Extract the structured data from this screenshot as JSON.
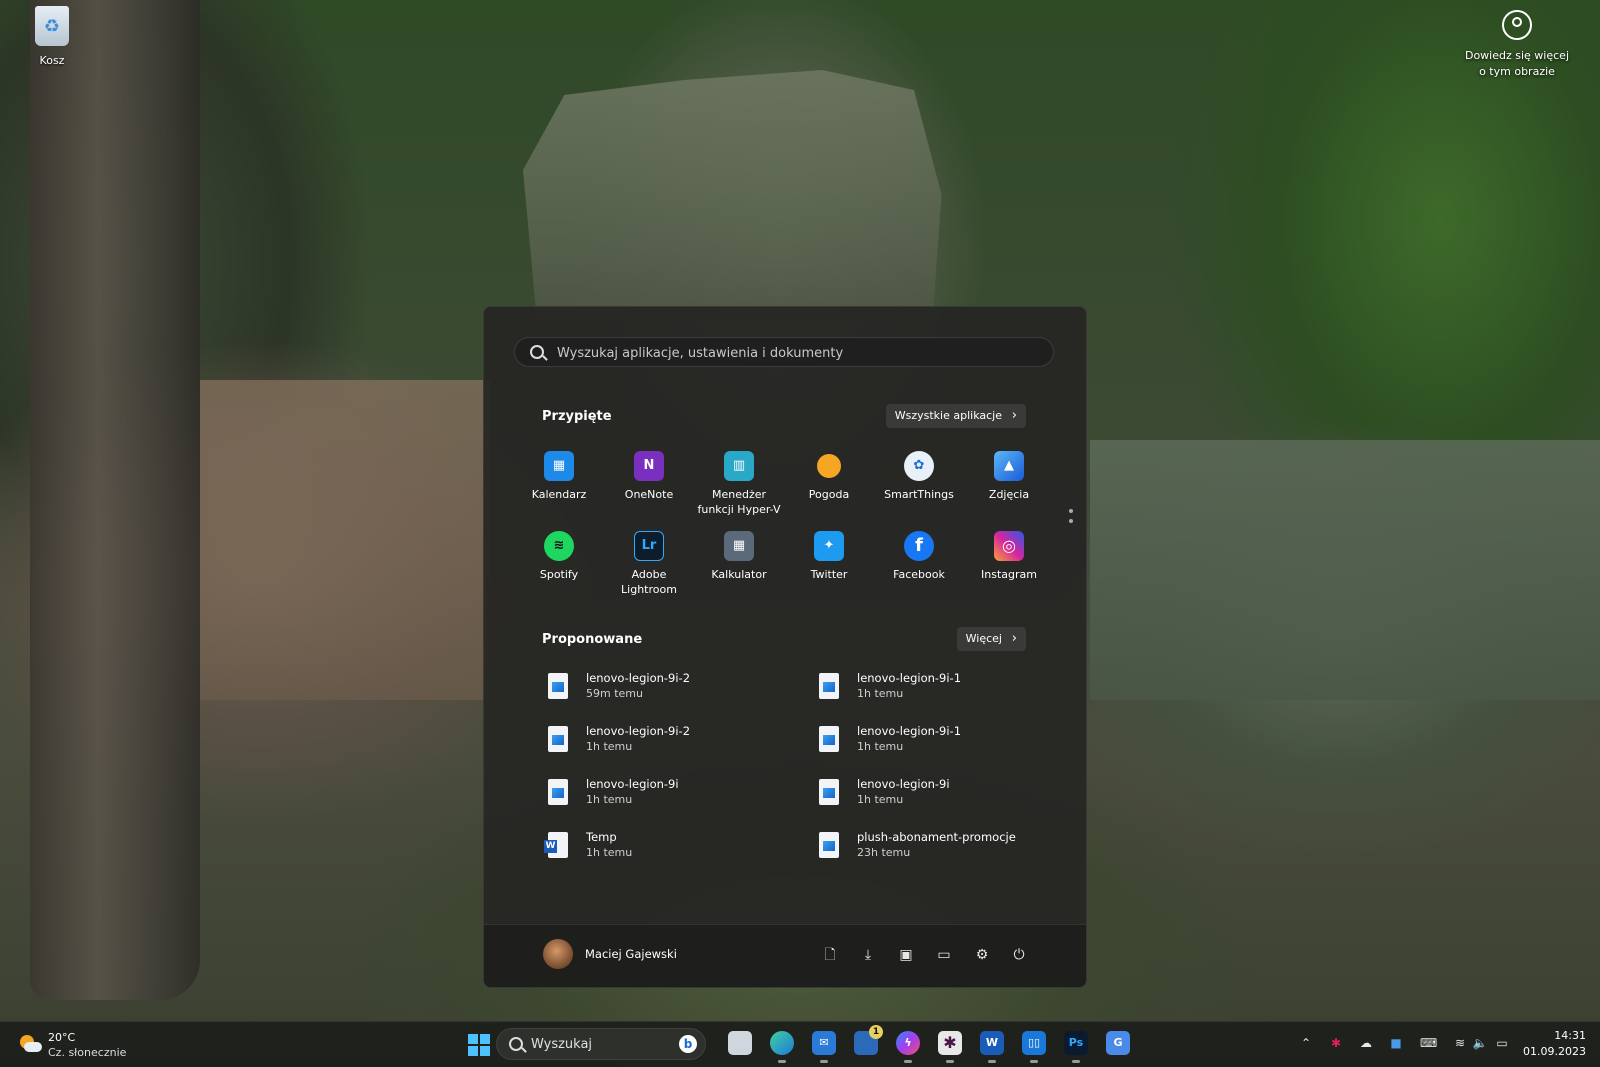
{
  "desktop": {
    "recycle_bin_label": "Kosz",
    "learn_more_line1": "Dowiedz się więcej",
    "learn_more_line2": "o tym obrazie"
  },
  "start_menu": {
    "search_placeholder": "Wyszukaj aplikacje, ustawienia i dokumenty",
    "pinned_title": "Przypięte",
    "all_apps_label": "Wszystkie aplikacje",
    "pinned_apps": [
      {
        "label_line1": "Kalendarz",
        "label_line2": "",
        "icon": "calendar-icon",
        "color": "#1e8ae8"
      },
      {
        "label_line1": "OneNote",
        "label_line2": "",
        "icon": "onenote-icon",
        "color": "#7b2fbf"
      },
      {
        "label_line1": "Menedżer",
        "label_line2": "funkcji Hyper-V",
        "icon": "hyperv-icon",
        "color": "#2aa8c8"
      },
      {
        "label_line1": "Pogoda",
        "label_line2": "",
        "icon": "weather-icon",
        "color": "#f5a623"
      },
      {
        "label_line1": "SmartThings",
        "label_line2": "",
        "icon": "smartthings-icon",
        "color": "#e8f0f8"
      },
      {
        "label_line1": "Zdjęcia",
        "label_line2": "",
        "icon": "photos-icon",
        "color": "#3a8ee8"
      },
      {
        "label_line1": "Spotify",
        "label_line2": "",
        "icon": "spotify-icon",
        "color": "#1ed760"
      },
      {
        "label_line1": "Adobe",
        "label_line2": "Lightroom",
        "icon": "lightroom-icon",
        "color": "#0e1d2c"
      },
      {
        "label_line1": "Kalkulator",
        "label_line2": "",
        "icon": "calculator-icon",
        "color": "#5a6a7a"
      },
      {
        "label_line1": "Twitter",
        "label_line2": "",
        "icon": "twitter-icon",
        "color": "#1d9bf0"
      },
      {
        "label_line1": "Facebook",
        "label_line2": "",
        "icon": "facebook-icon",
        "color": "#1877f2"
      },
      {
        "label_line1": "Instagram",
        "label_line2": "",
        "icon": "instagram-icon",
        "color": "#d6249f"
      }
    ],
    "recommended_title": "Proponowane",
    "more_label": "Więcej",
    "recommended": [
      {
        "name": "lenovo-legion-9i-2",
        "time": "59m temu",
        "type": "image"
      },
      {
        "name": "lenovo-legion-9i-1",
        "time": "1h temu",
        "type": "image"
      },
      {
        "name": "lenovo-legion-9i-2",
        "time": "1h temu",
        "type": "image"
      },
      {
        "name": "lenovo-legion-9i-1",
        "time": "1h temu",
        "type": "image"
      },
      {
        "name": "lenovo-legion-9i",
        "time": "1h temu",
        "type": "image"
      },
      {
        "name": "lenovo-legion-9i",
        "time": "1h temu",
        "type": "image"
      },
      {
        "name": "Temp",
        "time": "1h temu",
        "type": "word"
      },
      {
        "name": "plush-abonament-promocje",
        "time": "23h temu",
        "type": "image"
      }
    ],
    "user_name": "Maciej Gajewski",
    "footer_icons": [
      "document-icon",
      "download-icon",
      "pictures-icon",
      "file-explorer-icon",
      "settings-icon",
      "power-icon"
    ]
  },
  "taskbar": {
    "weather_temp": "20°C",
    "weather_desc": "Cz. słonecznie",
    "search_label": "Wyszukaj",
    "apps": [
      {
        "icon": "task-view-icon",
        "color": "#cfd6de",
        "running": false
      },
      {
        "icon": "edge-icon",
        "color": "#1e9ad8",
        "running": true
      },
      {
        "icon": "mail-icon",
        "color": "#2a7ad8",
        "running": true
      },
      {
        "icon": "store-icon",
        "color": "#2a6ab8",
        "running": false,
        "badge": "1"
      },
      {
        "icon": "messenger-icon",
        "color": "#a33ef0",
        "running": true
      },
      {
        "icon": "slack-icon",
        "color": "#e8e8e8",
        "running": true
      },
      {
        "icon": "word-icon",
        "color": "#1a5cb8",
        "running": true
      },
      {
        "icon": "trello-icon",
        "color": "#1a78d8",
        "running": true
      },
      {
        "icon": "photoshop-icon",
        "color": "#0a1a30",
        "running": true
      },
      {
        "icon": "translate-icon",
        "color": "#4a8ae8",
        "running": false
      }
    ],
    "clock_time": "14:31",
    "clock_date": "01.09.2023"
  }
}
